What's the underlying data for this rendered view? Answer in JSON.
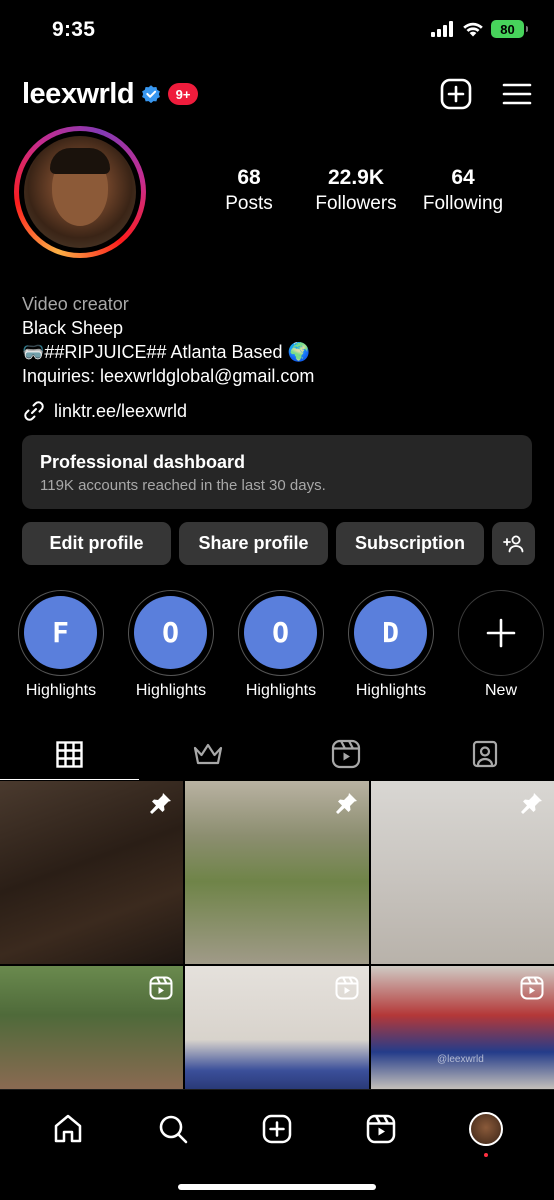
{
  "status_bar": {
    "time": "9:35",
    "battery": "80"
  },
  "header": {
    "username": "leexwrld",
    "notification_count": "9+"
  },
  "stats": [
    {
      "value": "68",
      "label": "Posts"
    },
    {
      "value": "22.9K",
      "label": "Followers"
    },
    {
      "value": "64",
      "label": "Following"
    }
  ],
  "bio": {
    "category": "Video creator",
    "line1": "Black Sheep",
    "line2": "🥽##RIPJUICE## Atlanta Based 🌍",
    "line3": "Inquiries: leexwrldglobal@gmail.com",
    "link": "linktr.ee/leexwrld"
  },
  "dashboard": {
    "title": "Professional dashboard",
    "subtitle": "119K accounts reached in the last 30 days."
  },
  "buttons": {
    "edit_profile": "Edit profile",
    "share_profile": "Share profile",
    "subscription": "Subscription"
  },
  "highlights": [
    {
      "letter": "F",
      "label": "Highlights"
    },
    {
      "letter": "O",
      "label": "Highlights"
    },
    {
      "letter": "O",
      "label": "Highlights"
    },
    {
      "letter": "D",
      "label": "Highlights"
    }
  ],
  "new_highlight_label": "New",
  "grid_watermark": "@leexwrld",
  "colors": {
    "background": "#000000",
    "button_bg": "#363636",
    "card_bg": "#262626",
    "highlight_fill": "#5a7fdc",
    "verified": "#3897f0",
    "badge_red": "#ef1c3c",
    "battery_green": "#47d35b"
  }
}
